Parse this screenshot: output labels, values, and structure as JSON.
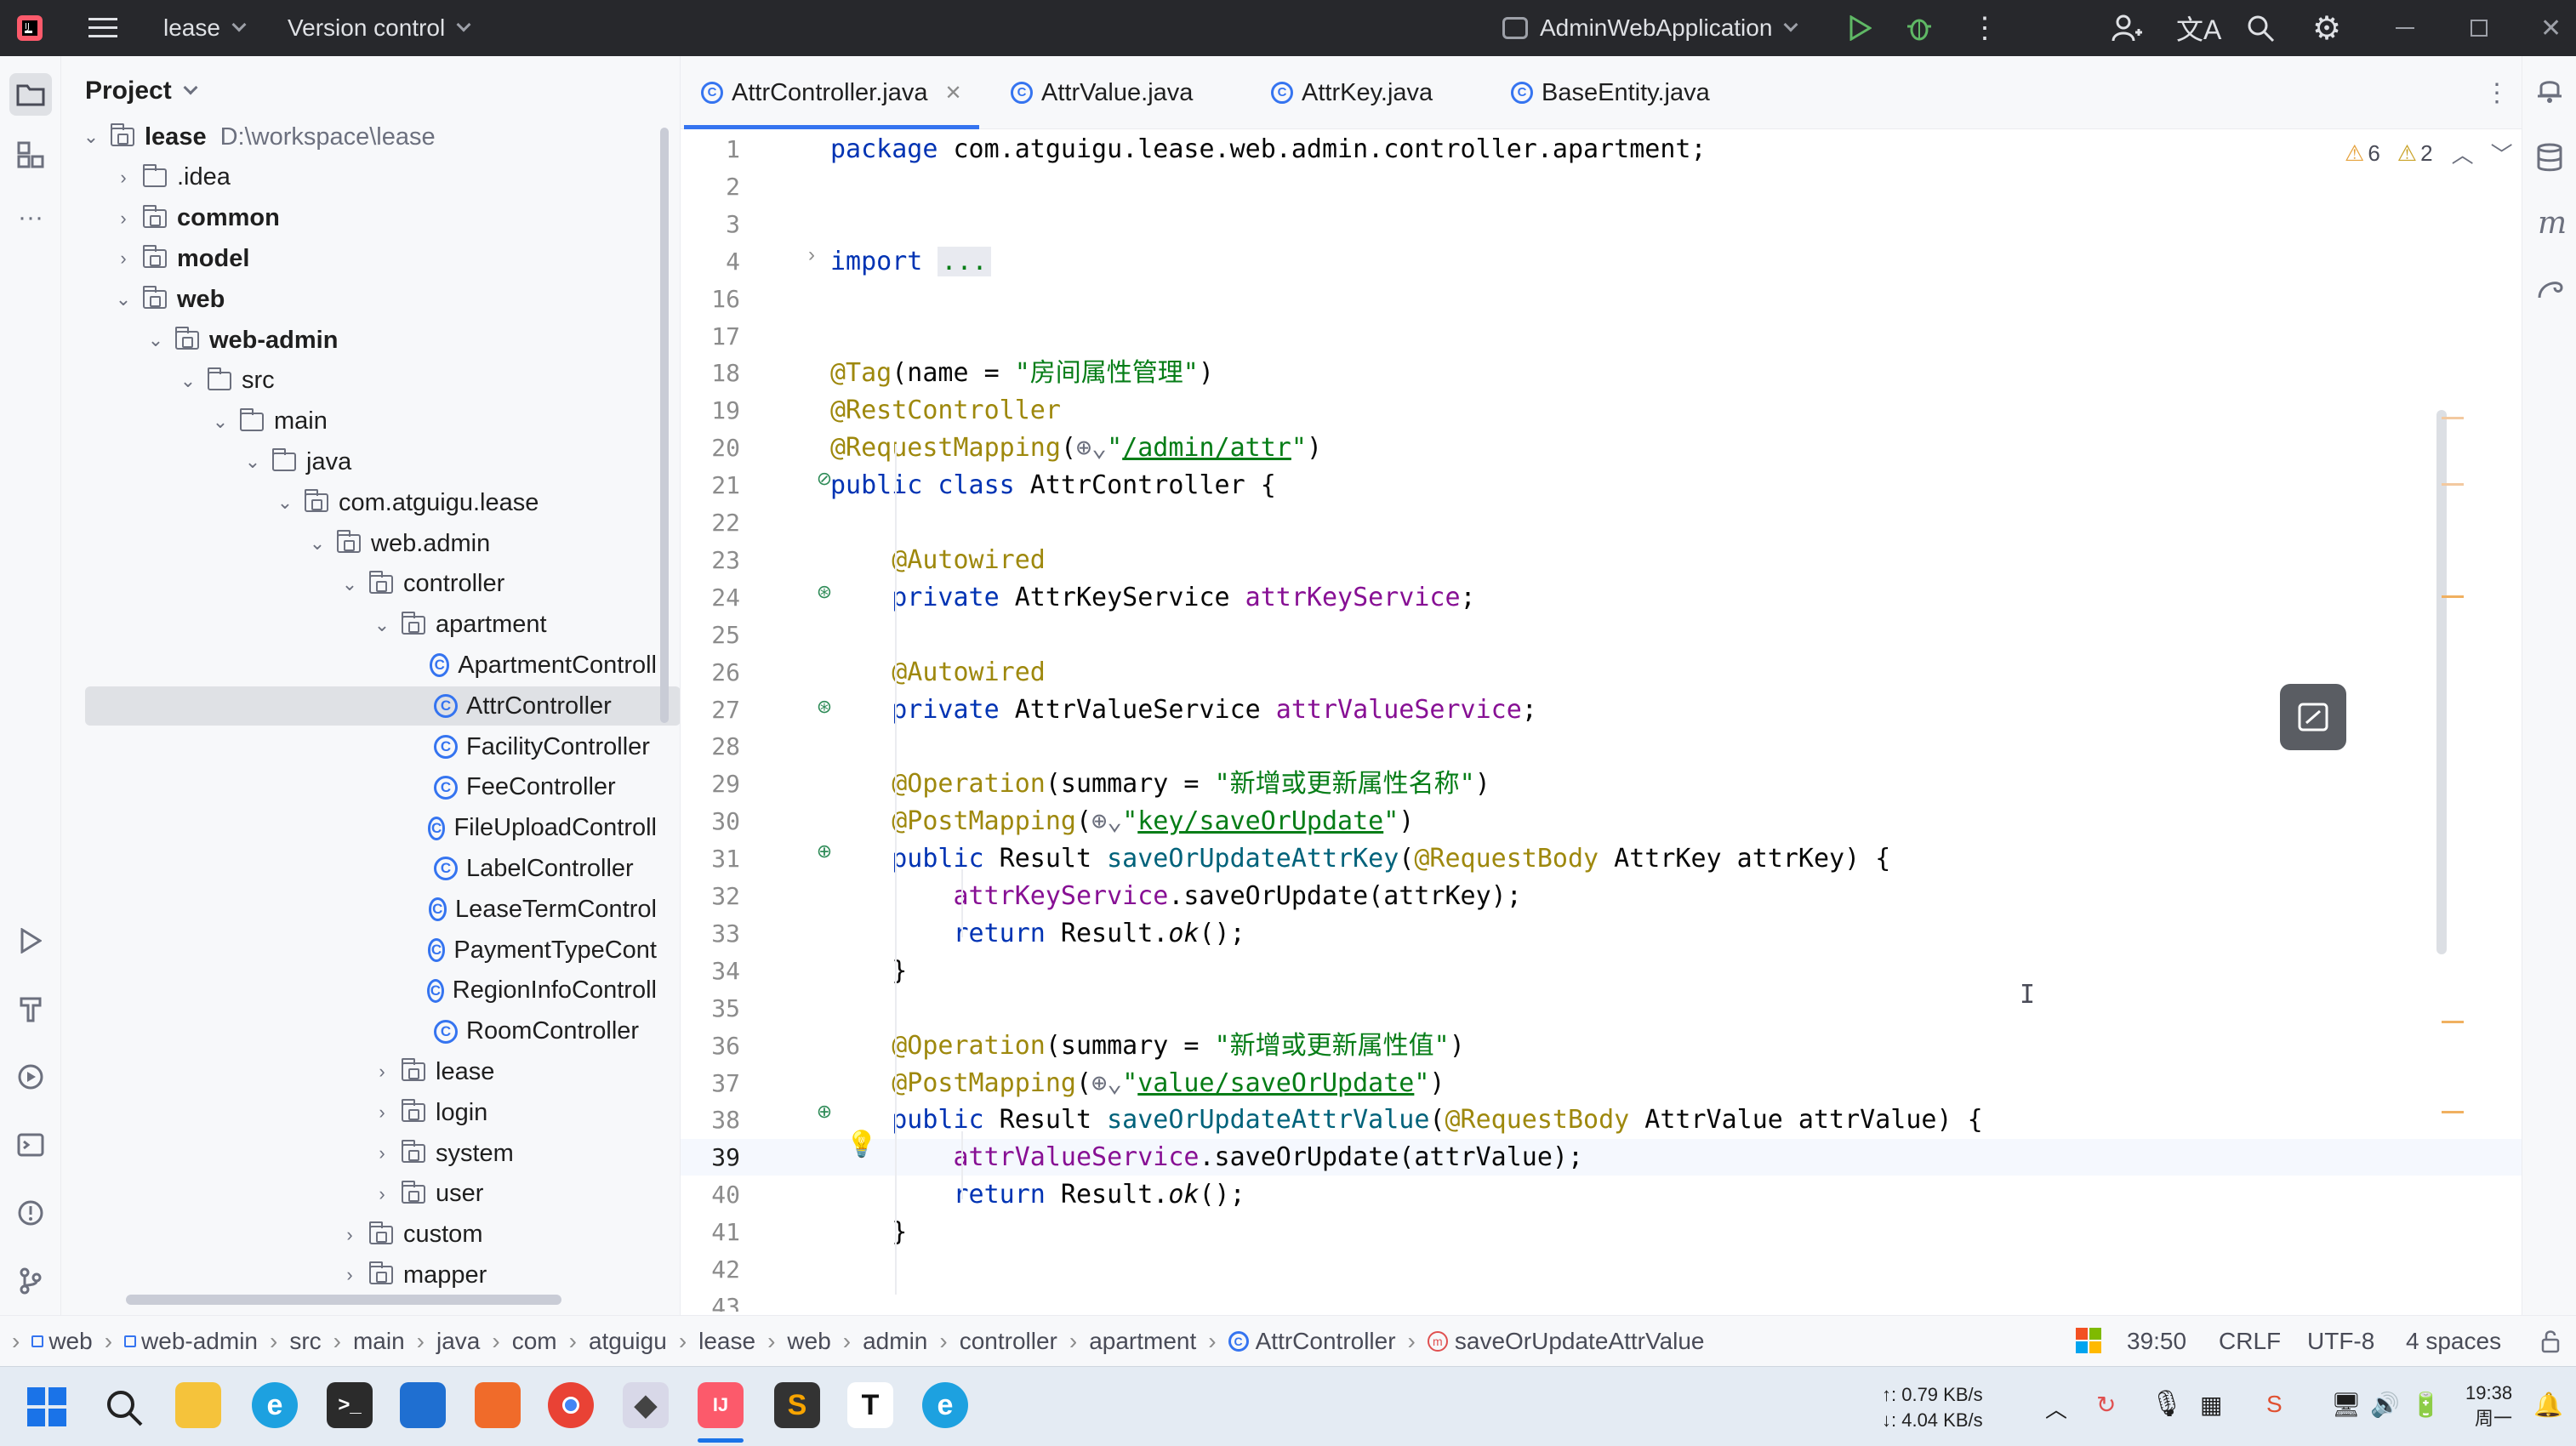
{
  "titlebar": {
    "project": "lease",
    "vcs": "Version control",
    "run_config": "AdminWebApplication"
  },
  "project_panel": {
    "title": "Project",
    "root_name": "lease",
    "root_path": "D:\\workspace\\lease",
    "items": [
      {
        "label": "lease",
        "kind": "root",
        "level": 0,
        "open": true
      },
      {
        "label": ".idea",
        "kind": "folder",
        "level": 1,
        "open": false
      },
      {
        "label": "common",
        "kind": "module",
        "level": 1,
        "open": false
      },
      {
        "label": "model",
        "kind": "module",
        "level": 1,
        "open": false
      },
      {
        "label": "web",
        "kind": "module",
        "level": 1,
        "open": true
      },
      {
        "label": "web-admin",
        "kind": "module",
        "level": 2,
        "open": true
      },
      {
        "label": "src",
        "kind": "folder",
        "level": 3,
        "open": true
      },
      {
        "label": "main",
        "kind": "folder",
        "level": 4,
        "open": true
      },
      {
        "label": "java",
        "kind": "folder",
        "level": 5,
        "open": true
      },
      {
        "label": "com.atguigu.lease",
        "kind": "package",
        "level": 6,
        "open": true
      },
      {
        "label": "web.admin",
        "kind": "package",
        "level": 7,
        "open": true
      },
      {
        "label": "controller",
        "kind": "package",
        "level": 8,
        "open": true
      },
      {
        "label": "apartment",
        "kind": "package",
        "level": 9,
        "open": true
      },
      {
        "label": "ApartmentControll",
        "kind": "class",
        "level": 10
      },
      {
        "label": "AttrController",
        "kind": "class",
        "level": 10,
        "selected": true
      },
      {
        "label": "FacilityController",
        "kind": "class",
        "level": 10
      },
      {
        "label": "FeeController",
        "kind": "class",
        "level": 10
      },
      {
        "label": "FileUploadControll",
        "kind": "class",
        "level": 10
      },
      {
        "label": "LabelController",
        "kind": "class",
        "level": 10
      },
      {
        "label": "LeaseTermControl",
        "kind": "class",
        "level": 10
      },
      {
        "label": "PaymentTypeCont",
        "kind": "class",
        "level": 10
      },
      {
        "label": "RegionInfoControll",
        "kind": "class",
        "level": 10
      },
      {
        "label": "RoomController",
        "kind": "class",
        "level": 10
      },
      {
        "label": "lease",
        "kind": "package",
        "level": 9,
        "open": false
      },
      {
        "label": "login",
        "kind": "package",
        "level": 9,
        "open": false
      },
      {
        "label": "system",
        "kind": "package",
        "level": 9,
        "open": false
      },
      {
        "label": "user",
        "kind": "package",
        "level": 9,
        "open": false
      },
      {
        "label": "custom",
        "kind": "package",
        "level": 8,
        "open": false
      },
      {
        "label": "mapper",
        "kind": "package",
        "level": 8,
        "open": false
      }
    ]
  },
  "tabs": [
    {
      "label": "AttrController.java",
      "active": true
    },
    {
      "label": "AttrValue.java"
    },
    {
      "label": "AttrKey.java"
    },
    {
      "label": "BaseEntity.java"
    }
  ],
  "inspections": {
    "warnings": "6",
    "weak_warnings": "2"
  },
  "code": [
    {
      "n": "1",
      "html": "<span class='kw'>package</span> com.atguigu.lease.web.admin.controller.apartment;"
    },
    {
      "n": "2",
      "html": ""
    },
    {
      "n": "3",
      "html": ""
    },
    {
      "n": "4",
      "html": "<span class='kw'>import</span> <span class='fold-dots'>...</span>"
    },
    {
      "n": "16",
      "html": ""
    },
    {
      "n": "17",
      "html": ""
    },
    {
      "n": "18",
      "html": "<span class='an'>@Tag</span>(name = <span class='st'>\"房间属性管理\"</span>)"
    },
    {
      "n": "19",
      "html": "<span class='an'>@RestController</span>"
    },
    {
      "n": "20",
      "html": "<span class='an'>@RequestMapping</span>(<span style='color:#6c707e'>⊕⌄</span><span class='st'>\"<span class='ul'>/admin/attr</span>\"</span>)"
    },
    {
      "n": "21",
      "html": "<span class='kw'>public class</span> AttrController {"
    },
    {
      "n": "22",
      "html": ""
    },
    {
      "n": "23",
      "html": "    <span class='an'>@Autowired</span>"
    },
    {
      "n": "24",
      "html": "    <span class='kw'>private</span> AttrKeyService <span class='fld'>attrKeyService</span>;"
    },
    {
      "n": "25",
      "html": ""
    },
    {
      "n": "26",
      "html": "    <span class='an'>@Autowired</span>"
    },
    {
      "n": "27",
      "html": "    <span class='kw'>private</span> AttrValueService <span class='fld'>attrValueService</span>;"
    },
    {
      "n": "28",
      "html": ""
    },
    {
      "n": "29",
      "html": "    <span class='an'>@Operation</span>(summary = <span class='st'>\"新增或更新属性名称\"</span>)"
    },
    {
      "n": "30",
      "html": "    <span class='an'>@PostMapping</span>(<span style='color:#6c707e'>⊕⌄</span><span class='st'>\"<span class='ul'>key/saveOrUpdate</span>\"</span>)"
    },
    {
      "n": "31",
      "html": "    <span class='kw'>public</span> Result <span class='mth'>saveOrUpdateAttrKey</span>(<span class='an'>@RequestBody</span> AttrKey attrKey) {"
    },
    {
      "n": "32",
      "html": "        <span class='fld'>attrKeyService</span>.saveOrUpdate(attrKey);"
    },
    {
      "n": "33",
      "html": "        <span class='kw'>return</span> Result.<span class='it'>ok</span>();"
    },
    {
      "n": "34",
      "html": "    }"
    },
    {
      "n": "35",
      "html": ""
    },
    {
      "n": "36",
      "html": "    <span class='an'>@Operation</span>(summary = <span class='st'>\"新增或更新属性值\"</span>)"
    },
    {
      "n": "37",
      "html": "    <span class='an'>@PostMapping</span>(<span style='color:#6c707e'>⊕⌄</span><span class='st'>\"<span class='ul'>value/saveOrUpdate</span>\"</span>)"
    },
    {
      "n": "38",
      "html": "    <span class='kw'>public</span> Result <span class='mth'>saveOrUpdateAttrValue</span>(<span class='an'>@RequestBody</span> AttrValue attrValue) {"
    },
    {
      "n": "39",
      "html": "        <span class='fld'>attrValueService</span>.saveOrUpdate(attrValue);",
      "current": true
    },
    {
      "n": "40",
      "html": "        <span class='kw'>return</span> Result.<span class='it'>ok</span>();"
    },
    {
      "n": "41",
      "html": "    }"
    },
    {
      "n": "42",
      "html": ""
    },
    {
      "n": "43",
      "html": ""
    }
  ],
  "breadcrumbs": [
    "web",
    "web-admin",
    "src",
    "main",
    "java",
    "com",
    "atguigu",
    "lease",
    "web",
    "admin",
    "controller",
    "apartment",
    "AttrController",
    "saveOrUpdateAttrValue"
  ],
  "status": {
    "position": "39:50",
    "line_sep": "CRLF",
    "encoding": "UTF-8",
    "indent": "4 spaces"
  },
  "taskbar": {
    "net_up": "↑: 0.79 KB/s",
    "net_down": "↓: 4.04 KB/s",
    "time": "19:38",
    "day": "周一"
  }
}
